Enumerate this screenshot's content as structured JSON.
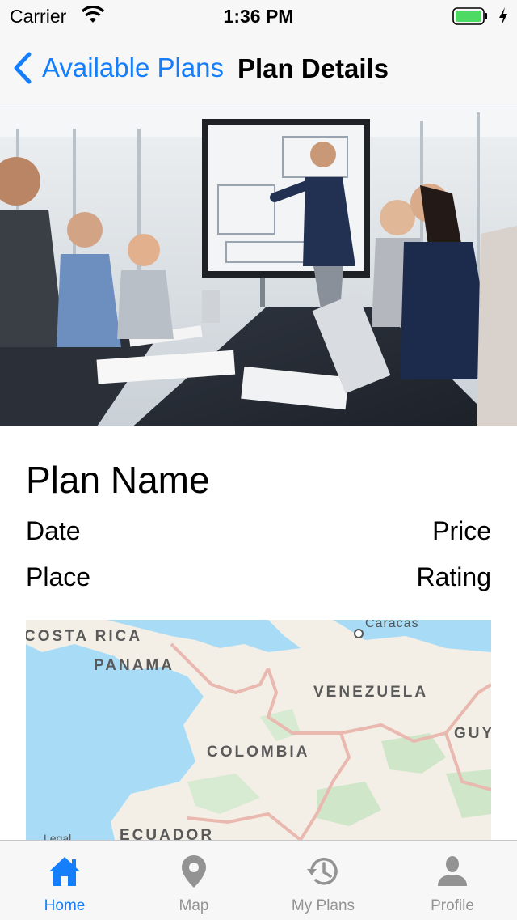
{
  "status_bar": {
    "carrier": "Carrier",
    "time": "1:36 PM"
  },
  "nav": {
    "back_label": "Available Plans",
    "title": "Plan Details"
  },
  "plan": {
    "name": "Plan Name",
    "date_label": "Date",
    "price_label": "Price",
    "place_label": "Place",
    "rating_label": "Rating"
  },
  "map": {
    "countries": [
      "COSTA RICA",
      "PANAMA",
      "VENEZUELA",
      "COLOMBIA",
      "GUY",
      "ECUADOR"
    ],
    "city": "Caracas",
    "legal": "Legal"
  },
  "tabs": [
    {
      "label": "Home",
      "icon": "home-icon",
      "active": true
    },
    {
      "label": "Map",
      "icon": "map-pin-icon",
      "active": false
    },
    {
      "label": "My Plans",
      "icon": "history-icon",
      "active": false
    },
    {
      "label": "Profile",
      "icon": "person-icon",
      "active": false
    }
  ],
  "colors": {
    "accent": "#147efb",
    "inactive": "#939393",
    "battery": "#4cd964"
  }
}
